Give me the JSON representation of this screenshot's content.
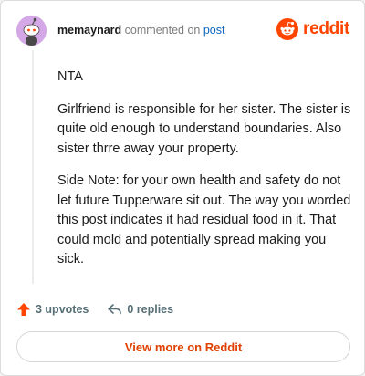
{
  "header": {
    "username": "memaynard",
    "action_text": "commented on",
    "post_link": "post"
  },
  "brand": {
    "logo_text": "reddit",
    "icon": "reddit-alien-icon",
    "color": "#ff4500"
  },
  "comment": {
    "paragraphs": [
      "NTA",
      "Girlfriend is responsible for her sister. The sister is quite old enough to understand boundaries. Also sister thrre away your property.",
      "Side Note: for your own health and safety do not let future Tupperware sit out. The way you worded this post indicates it had residual food in it. That could mold and potentially spread making you sick."
    ]
  },
  "actions": {
    "upvotes_label": "3 upvotes",
    "replies_label": "0 replies"
  },
  "footer": {
    "view_more_label": "View more on Reddit"
  },
  "colors": {
    "accent": "#ff4500",
    "link": "#0a66c2",
    "avatar_bg": "#d4a7e6"
  }
}
